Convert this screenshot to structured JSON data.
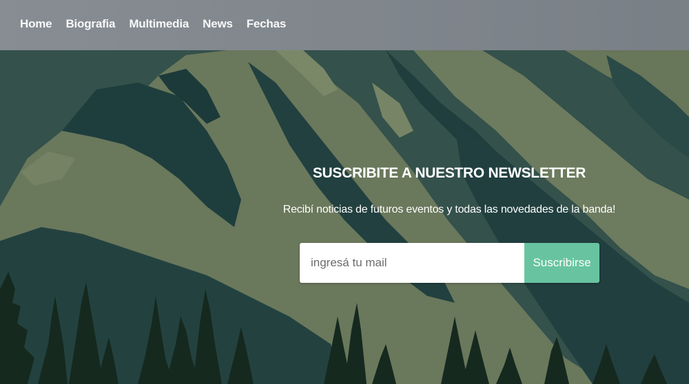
{
  "nav": {
    "items": [
      {
        "label": "Home"
      },
      {
        "label": "Biografia"
      },
      {
        "label": "Multimedia"
      },
      {
        "label": "News"
      },
      {
        "label": "Fechas"
      }
    ]
  },
  "newsletter": {
    "title": "SUSCRIBITE A NUESTRO NEWSLETTER",
    "description": "Recibí noticias de futuros eventos y todas las novedades de la banda!",
    "email_placeholder": "ingresá tu mail",
    "email_value": "",
    "submit_label": "Suscribirse"
  },
  "colors": {
    "navbar": "#7f858c",
    "accent": "#68c4a0",
    "background_dark": "#1f3d3c",
    "background_sage": "#6c7a5d",
    "trees": "#162a22"
  }
}
